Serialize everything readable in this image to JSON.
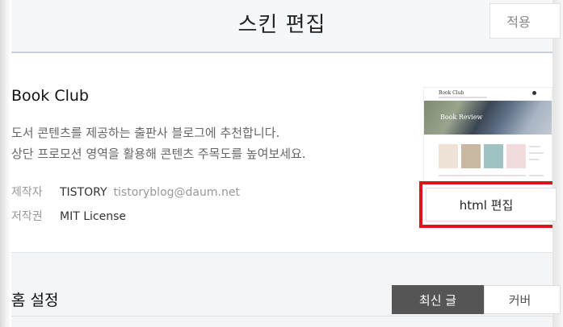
{
  "header": {
    "title": "스킨 편집",
    "apply_label": "적용"
  },
  "skin": {
    "name": "Book Club",
    "description_line1": "도서 콘텐츠를 제공하는 출판사 블로그에 추천합니다.",
    "description_line2": "상단 프로모션 영역을 활용해 콘텐츠 주목도를 높여보세요.",
    "maker_label": "제작자",
    "maker_value": "TISTORY",
    "maker_email": "tistoryblog@daum.net",
    "license_label": "저작권",
    "license_value": "MIT License",
    "thumbnail": {
      "logo_text": "Book Club",
      "hero_text": "Book Review"
    },
    "html_edit_label": "html 편집"
  },
  "home": {
    "title": "홈 설정",
    "options": [
      {
        "label": "최신 글",
        "selected": true
      },
      {
        "label": "커버",
        "selected": false
      }
    ]
  },
  "colors": {
    "highlight": "#d8161d",
    "selected_segment": "#555555",
    "header_bg": "#f6f7f9"
  }
}
